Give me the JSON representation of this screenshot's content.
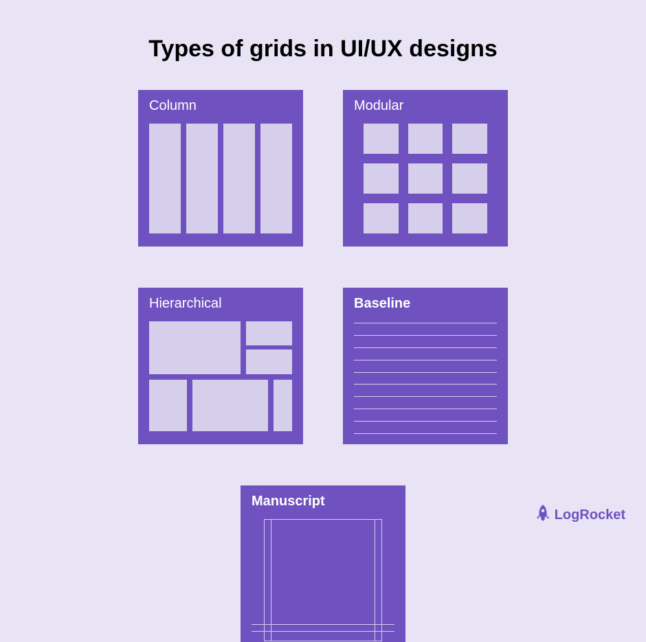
{
  "title": "Types of grids in UI/UX designs",
  "grids": {
    "column": {
      "label": "Column"
    },
    "modular": {
      "label": "Modular"
    },
    "hierarchical": {
      "label": "Hierarchical"
    },
    "baseline": {
      "label": "Baseline"
    },
    "manuscript": {
      "label": "Manuscript"
    }
  },
  "logo": {
    "text": "LogRocket"
  },
  "colors": {
    "background": "#e8e3f5",
    "card": "#6f52c0",
    "cell": "#d6cfeb",
    "text": "#ffffff"
  }
}
